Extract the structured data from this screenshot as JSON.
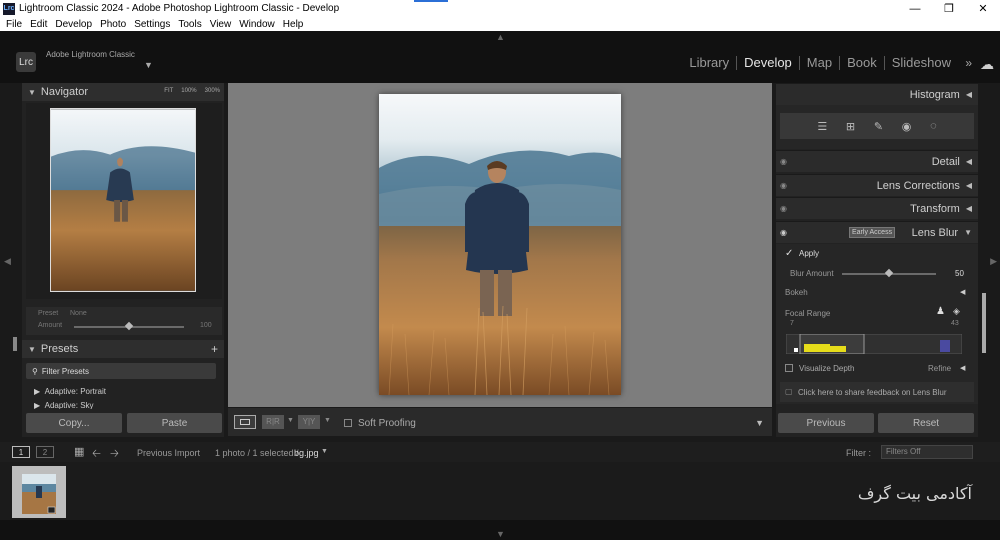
{
  "window": {
    "title": "Lightroom Classic 2024 - Adobe Photoshop Lightroom Classic - Develop",
    "app_icon": "Lrc"
  },
  "menu": [
    "File",
    "Edit",
    "Develop",
    "Photo",
    "Settings",
    "Tools",
    "View",
    "Window",
    "Help"
  ],
  "identity": {
    "logo": "Lrc",
    "brand": "Adobe Lightroom Classic"
  },
  "modules": [
    "Library",
    "Develop",
    "Map",
    "Book",
    "Slideshow"
  ],
  "active_module": "Develop",
  "navigator": {
    "title": "Navigator",
    "zoom": [
      "FIT",
      "100%",
      "300%"
    ]
  },
  "preset_box": {
    "preset_label": "Preset",
    "preset_value": "None",
    "amount_label": "Amount",
    "amount_value": "100"
  },
  "presets": {
    "title": "Presets",
    "filter": "Filter Presets",
    "items": [
      "Adaptive: Portrait",
      "Adaptive: Sky"
    ]
  },
  "left_buttons": {
    "copy": "Copy...",
    "paste": "Paste"
  },
  "toolbar": {
    "soft_proofing": "Soft Proofing"
  },
  "right_panel": {
    "histogram": "Histogram",
    "detail": "Detail",
    "lens_corrections": "Lens Corrections",
    "transform": "Transform",
    "lens_blur": "Lens Blur",
    "early_access": "Early Access",
    "apply": "Apply",
    "blur_amount_label": "Blur Amount",
    "blur_amount_value": "50",
    "bokeh": "Bokeh",
    "focal_range": "Focal Range",
    "focal_min": "7",
    "focal_max": "43",
    "visualize_depth": "Visualize Depth",
    "refine": "Refine",
    "feedback": "Click here to share feedback on Lens Blur",
    "previous": "Previous",
    "reset": "Reset"
  },
  "filmstrip": {
    "page1": "1",
    "page2": "2",
    "source": "Previous Import",
    "count": "1 photo / 1 selected /",
    "filename": "bg.jpg",
    "filter_label": "Filter :",
    "filter_value": "Filters Off",
    "watermark": "آکادمی بیت گرف"
  }
}
